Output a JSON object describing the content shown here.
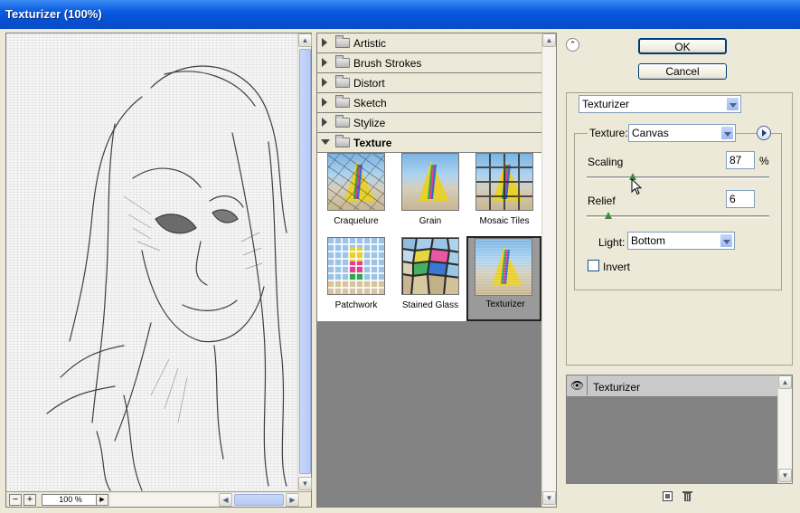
{
  "window": {
    "title": "Texturizer (100%)"
  },
  "preview": {
    "zoom_minus": "−",
    "zoom_plus": "+",
    "zoom_value": "100 %"
  },
  "filter_categories": [
    {
      "label": "Artistic",
      "expanded": false
    },
    {
      "label": "Brush Strokes",
      "expanded": false
    },
    {
      "label": "Distort",
      "expanded": false
    },
    {
      "label": "Sketch",
      "expanded": false
    },
    {
      "label": "Stylize",
      "expanded": false
    },
    {
      "label": "Texture",
      "expanded": true
    }
  ],
  "texture_filters": [
    {
      "label": "Craquelure",
      "selected": false
    },
    {
      "label": "Grain",
      "selected": false
    },
    {
      "label": "Mosaic Tiles",
      "selected": false
    },
    {
      "label": "Patchwork",
      "selected": false
    },
    {
      "label": "Stained Glass",
      "selected": false
    },
    {
      "label": "Texturizer",
      "selected": true
    }
  ],
  "buttons": {
    "ok": "OK",
    "cancel": "Cancel"
  },
  "settings": {
    "filter_select": "Texturizer",
    "texture_label": "Texture:",
    "texture_value": "Canvas",
    "scaling_label": "Scaling",
    "scaling_value": "87",
    "scaling_unit": "%",
    "scaling_fraction": 0.25,
    "relief_label": "Relief",
    "relief_value": "6",
    "relief_fraction": 0.12,
    "light_label": "Light:",
    "light_value": "Bottom",
    "invert_label": "Invert",
    "invert_checked": false
  },
  "layers": [
    {
      "name": "Texturizer",
      "visible": true
    }
  ],
  "colors": {
    "title_bar": "#0a5adf",
    "panel_bg": "#ece9d8",
    "list_bg": "#838383"
  }
}
